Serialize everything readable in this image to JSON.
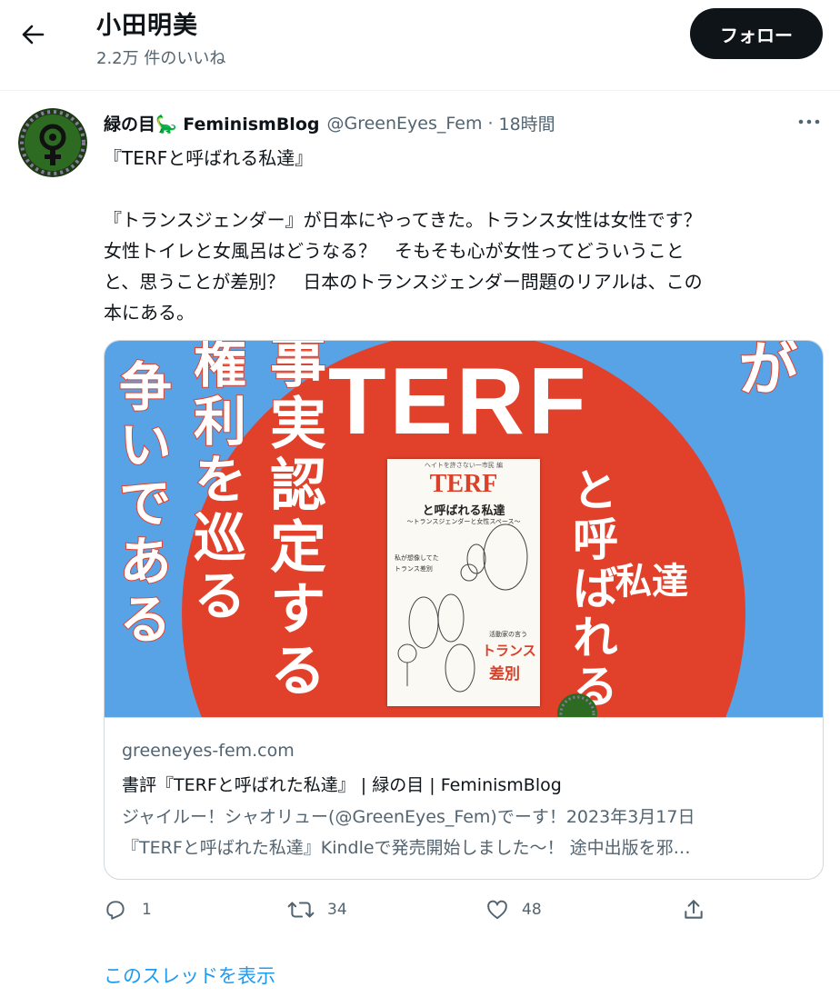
{
  "header": {
    "title": "小田明美",
    "subtitle": "2.2万 件のいいね",
    "follow_label": "フォロー"
  },
  "tweet": {
    "author_name": "緑の目🦕 FeminismBlog",
    "handle": "@GreenEyes_Fem",
    "separator": "·",
    "time": "18時間",
    "text": "『TERFと呼ばれる私達』\n\n『トランスジェンダー』が日本にやってきた。トランス女性は女性です？\n女性トイレと女風呂はどうなる？　そもそも心が女性ってどういうこと\nと、思うことが差別？　日本のトランスジェンダー問題のリアルは、この\n本にある。",
    "card": {
      "image": {
        "big_title": "TERF",
        "col_a": "争いである",
        "col_b": "権利を巡る",
        "col_c": "事実認定する",
        "col_d": "と呼ばれる",
        "col_e": "私達",
        "col_f": "これは女性が",
        "book_top": "ヘイトを許さない一市民 編",
        "book_title": "TERF",
        "book_title2": "と呼ばれる私達",
        "book_sub": "〜トランスジェンダーと女性スペース〜",
        "book_left1": "私が想像してた",
        "book_left2": "トランス差別",
        "book_right1": "活動家の言う",
        "book_right2": "トランス",
        "book_right3": "差別"
      },
      "domain": "greeneyes-fem.com",
      "title": "書評『TERFと呼ばれた私達』 | 緑の目 | FeminismBlog",
      "description": "ジャイルー！シャオリュー(@GreenEyes_Fem)でーす！2023年3月17日\n『TERFと呼ばれた私達』Kindleで発売開始しました〜！ 途中出版を邪…"
    },
    "actions": {
      "replies": "1",
      "retweets": "34",
      "likes": "48"
    }
  },
  "thread_link": "このスレッドを表示",
  "colors": {
    "accent": "#1d9bf0",
    "text": "#0f1419",
    "muted": "#536471",
    "card_blue": "#57a3e6",
    "card_red": "#e1412a",
    "avatar_green": "#2e6b22"
  },
  "icons": [
    "back-arrow-icon",
    "more-icon",
    "reply-icon",
    "retweet-icon",
    "like-icon",
    "share-icon"
  ]
}
